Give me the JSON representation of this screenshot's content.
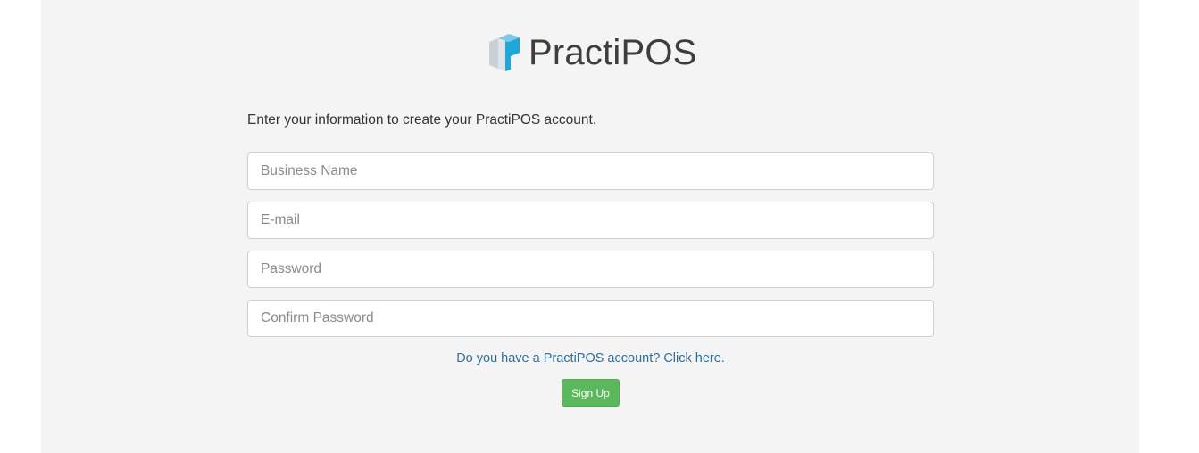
{
  "brand": {
    "name": "PractiPOS",
    "logo_icon": "cube-p-logo-icon",
    "logo_colors": [
      "#1fa7d8",
      "#7cc8ea",
      "#c9d0d6",
      "#dfe4e8"
    ]
  },
  "form": {
    "intro_text": "Enter your information to create your PractiPOS account.",
    "business_name_placeholder": "Business Name",
    "email_placeholder": "E-mail",
    "password_placeholder": "Password",
    "confirm_password_placeholder": "Confirm Password",
    "login_link_text": "Do you have a PractiPOS account? Click here.",
    "signup_label": "Sign Up"
  },
  "colors": {
    "panel_background": "#f4f4f4",
    "link": "#2f6f9f",
    "signup_button": "#5cb85c"
  }
}
